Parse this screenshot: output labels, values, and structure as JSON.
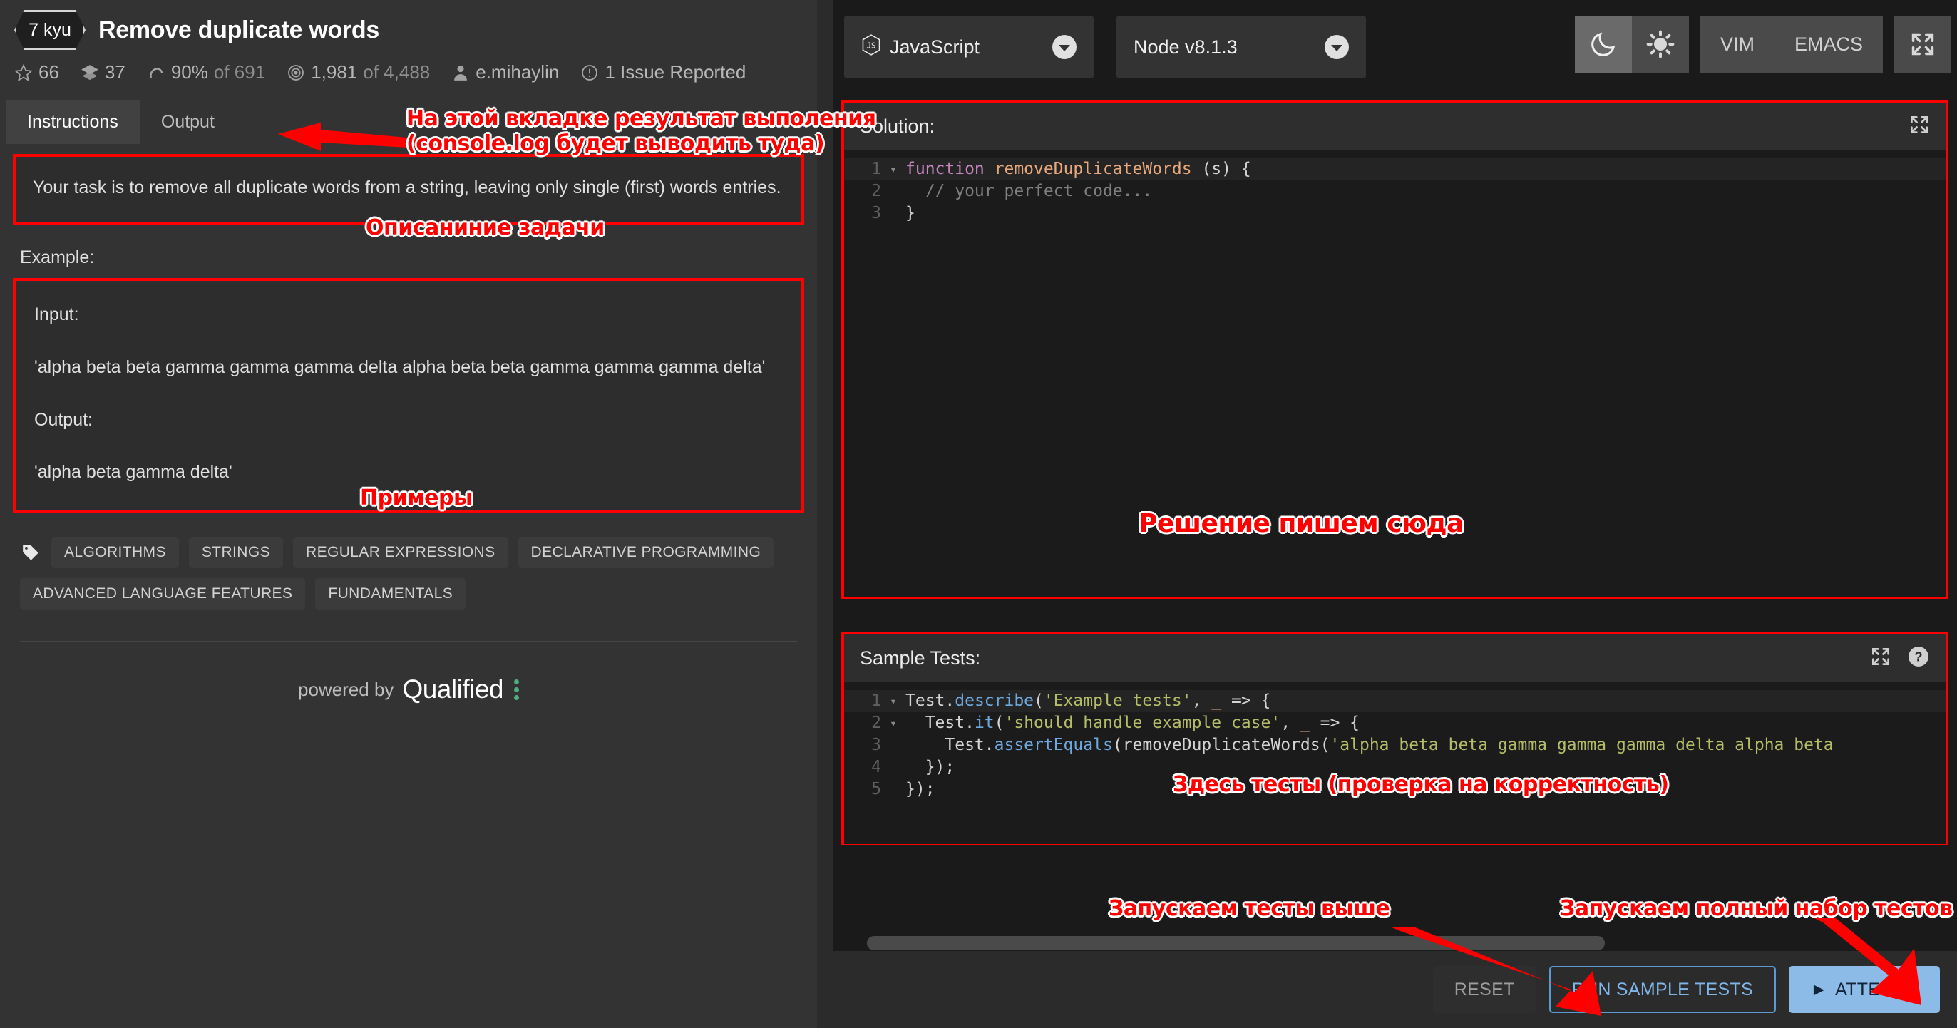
{
  "kata": {
    "kyu": "7 kyu",
    "title": "Remove duplicate words",
    "stats": {
      "stars": "66",
      "collections": "37",
      "satisfaction": "90%",
      "satisfaction_of": "of 691",
      "completed": "1,981",
      "completed_of": "of 4,488",
      "author": "e.mihaylin",
      "issues": "1 Issue Reported"
    }
  },
  "tabs": [
    {
      "label": "Instructions",
      "active": true
    },
    {
      "label": "Output",
      "active": false
    }
  ],
  "description": {
    "text": "Your task is to remove all duplicate words from a string, leaving only single (first) words entries.",
    "example_label": "Example:",
    "input_label": "Input:",
    "input_value": "'alpha beta beta gamma gamma gamma delta alpha beta beta gamma gamma gamma delta'",
    "output_label": "Output:",
    "output_value": "'alpha beta gamma delta'"
  },
  "tags": [
    "ALGORITHMS",
    "STRINGS",
    "REGULAR EXPRESSIONS",
    "DECLARATIVE PROGRAMMING",
    "ADVANCED LANGUAGE FEATURES",
    "FUNDAMENTALS"
  ],
  "footer": {
    "powered_by": "powered by",
    "brand": "Qualified"
  },
  "toolbar": {
    "language": "JavaScript",
    "runtime": "Node v8.1.3",
    "vim": "VIM",
    "emacs": "EMACS"
  },
  "solution": {
    "title": "Solution:",
    "lines": [
      {
        "n": "1",
        "fold": "▾",
        "highlight": true,
        "tokens": [
          {
            "t": "function",
            "c": "k-kw"
          },
          {
            "t": " ",
            "c": "k-pl"
          },
          {
            "t": "removeDuplicateWords",
            "c": "k-fn"
          },
          {
            "t": " (s) {",
            "c": "k-pl"
          }
        ]
      },
      {
        "n": "2",
        "fold": "",
        "highlight": false,
        "tokens": [
          {
            "t": "  // your perfect code...",
            "c": "k-cm"
          }
        ]
      },
      {
        "n": "3",
        "fold": "",
        "highlight": false,
        "tokens": [
          {
            "t": "}",
            "c": "k-pl"
          }
        ]
      }
    ]
  },
  "sample_tests": {
    "title": "Sample Tests:",
    "lines": [
      {
        "n": "1",
        "fold": "▾",
        "highlight": true,
        "tokens": [
          {
            "t": "Test.",
            "c": "k-pl"
          },
          {
            "t": "describe",
            "c": "k-mth"
          },
          {
            "t": "(",
            "c": "k-pl"
          },
          {
            "t": "'Example tests'",
            "c": "k-str"
          },
          {
            "t": ", ",
            "c": "k-pl"
          },
          {
            "t": "_",
            "c": "k-var"
          },
          {
            "t": " => {",
            "c": "k-pl"
          }
        ]
      },
      {
        "n": "2",
        "fold": "▾",
        "highlight": false,
        "tokens": [
          {
            "t": "  Test.",
            "c": "k-pl"
          },
          {
            "t": "it",
            "c": "k-mth"
          },
          {
            "t": "(",
            "c": "k-pl"
          },
          {
            "t": "'should handle example case'",
            "c": "k-str"
          },
          {
            "t": ", ",
            "c": "k-pl"
          },
          {
            "t": "_",
            "c": "k-var"
          },
          {
            "t": " => {",
            "c": "k-pl"
          }
        ]
      },
      {
        "n": "3",
        "fold": "",
        "highlight": false,
        "tokens": [
          {
            "t": "    Test.",
            "c": "k-pl"
          },
          {
            "t": "assertEquals",
            "c": "k-mth"
          },
          {
            "t": "(removeDuplicateWords(",
            "c": "k-pl"
          },
          {
            "t": "'alpha beta beta gamma gamma gamma delta alpha beta",
            "c": "k-str"
          }
        ]
      },
      {
        "n": "4",
        "fold": "",
        "highlight": false,
        "tokens": [
          {
            "t": "  });",
            "c": "k-pl"
          }
        ]
      },
      {
        "n": "5",
        "fold": "",
        "highlight": false,
        "tokens": [
          {
            "t": "});",
            "c": "k-pl"
          }
        ]
      }
    ]
  },
  "buttons": {
    "reset": "RESET",
    "run_sample_tests": "RUN SAMPLE TESTS",
    "attempt": "ATTEMPT"
  },
  "annotations": {
    "output_tab_l1": "На этой вкладке результат выполения",
    "output_tab_l2": "(console.log будет выводить туда)",
    "task_description": "Описаниние задачи",
    "examples": "Примеры",
    "solution_here": "Решение пишем сюда",
    "tests_here": "Здесь тесты (проверка на корректность)",
    "run_tests_above": "Запускаем тесты выше",
    "run_full_suite": "Запускаем полный набор тестов"
  },
  "colors": {
    "annotation": "#ff0000",
    "attempt_bg": "#8cbbe8",
    "run_border": "#5b9bd5",
    "brand_dot": "#4caf7d"
  }
}
